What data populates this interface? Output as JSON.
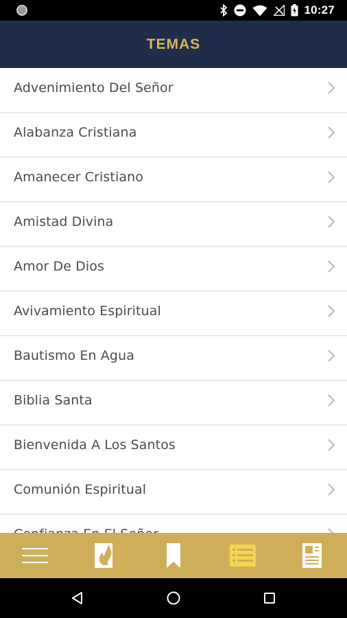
{
  "status_bar": {
    "time": "10:27",
    "icons": [
      "notification-dot-icon",
      "bluetooth-icon",
      "do-not-disturb-icon",
      "wifi-icon",
      "no-signal-icon",
      "battery-icon"
    ]
  },
  "header": {
    "title": "TEMAS",
    "background": "#1f2d4a",
    "title_color": "#d9b55a"
  },
  "topics": [
    {
      "label": "Advenimiento Del Señor"
    },
    {
      "label": "Alabanza Cristiana"
    },
    {
      "label": "Amanecer Cristiano"
    },
    {
      "label": "Amistad Divina"
    },
    {
      "label": "Amor De Dios"
    },
    {
      "label": "Avivamiento Espiritual"
    },
    {
      "label": "Bautismo En Agua"
    },
    {
      "label": "Biblia Santa"
    },
    {
      "label": "Bienvenida A Los Santos"
    },
    {
      "label": "Comunión Espiritual"
    },
    {
      "label": "Confianza En El Señor"
    }
  ],
  "bottom_nav": {
    "background": "#cfae5a",
    "items": [
      {
        "icon": "menu-icon",
        "active": false
      },
      {
        "icon": "flame-book-icon",
        "active": false
      },
      {
        "icon": "bookmark-icon",
        "active": false
      },
      {
        "icon": "list-icon",
        "active": true
      },
      {
        "icon": "newspaper-icon",
        "active": false
      }
    ]
  },
  "system_nav": {
    "buttons": [
      "back-icon",
      "home-icon",
      "recents-icon"
    ]
  }
}
